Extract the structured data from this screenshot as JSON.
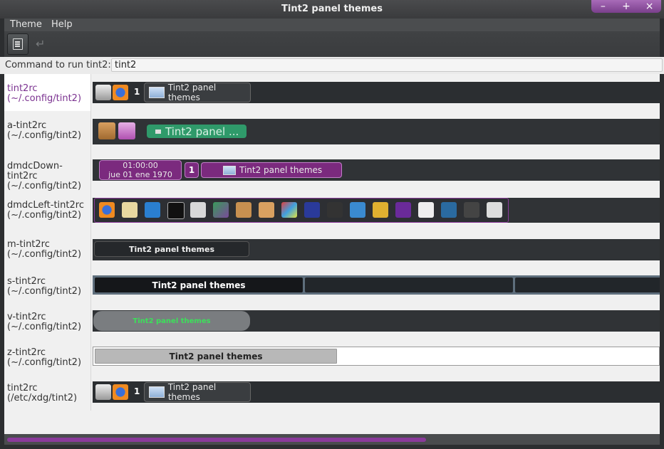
{
  "window": {
    "title": "Tint2 panel themes",
    "controls": [
      "–",
      "+",
      "×"
    ]
  },
  "menu": {
    "items": [
      "Theme",
      "Help"
    ]
  },
  "toolbar": {
    "list_button": "list-icon",
    "disabled_button": "↵"
  },
  "command": {
    "label": "Command to run tint2:",
    "value": "tint2"
  },
  "themes": [
    {
      "name": "tint2rc",
      "path": "(~/.config/tint2)",
      "selected": true
    },
    {
      "name": "a-tint2rc",
      "path": "(~/.config/tint2)"
    },
    {
      "name": "dmdcDown-tint2rc",
      "path": "(~/.config/tint2)"
    },
    {
      "name": "dmdcLeft-tint2rc",
      "path": "(~/.config/tint2)"
    },
    {
      "name": "m-tint2rc",
      "path": "(~/.config/tint2)"
    },
    {
      "name": "s-tint2rc",
      "path": "(~/.config/tint2)"
    },
    {
      "name": "v-tint2rc",
      "path": "(~/.config/tint2)"
    },
    {
      "name": "z-tint2rc",
      "path": "(~/.config/tint2)"
    },
    {
      "name": "tint2rc",
      "path": "(/etc/xdg/tint2)"
    }
  ],
  "previews": {
    "p0": {
      "desktop": "1",
      "task": "Tint2 panel themes"
    },
    "p1": {
      "task": "Tint2 panel ..."
    },
    "p2": {
      "time": "01:00:00",
      "date": "jue 01 ene 1970",
      "desktop": "1",
      "task": "Tint2 panel themes"
    },
    "p4": {
      "task": "Tint2 panel themes"
    },
    "p5": {
      "task": "Tint2 panel themes"
    },
    "p6": {
      "task": "Tint2 panel themes"
    },
    "p7": {
      "task": "Tint2 panel themes"
    },
    "p8": {
      "desktop": "1",
      "task": "Tint2 panel themes"
    }
  },
  "colors": {
    "accent": "#7b3290",
    "selected_text": "#7b3290",
    "green_task": "#2f9a6a"
  }
}
